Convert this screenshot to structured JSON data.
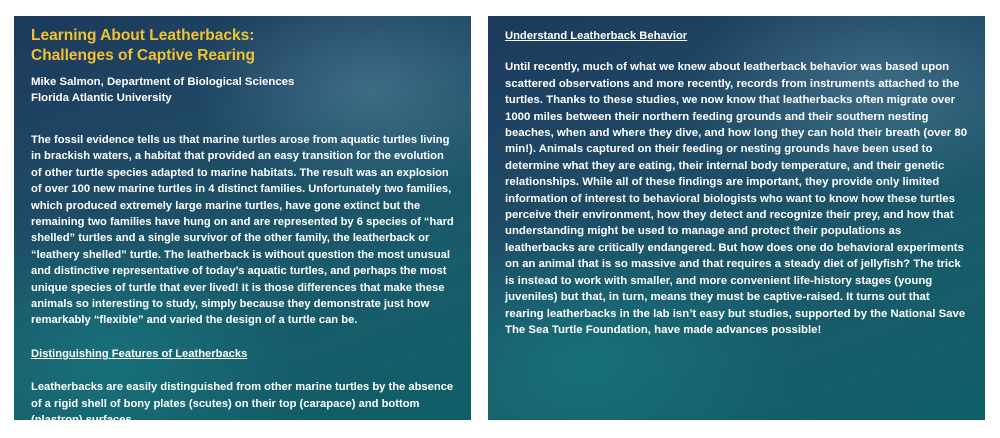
{
  "left_panel": {
    "title_line1": "Learning About Leatherbacks:",
    "title_line2": "Challenges of Captive Rearing",
    "author_line1": "Mike Salmon, Department of Biological Sciences",
    "author_line2": "Florida Atlantic University",
    "paragraph1": "The fossil evidence tells us that marine turtles arose from aquatic turtles living in brackish waters, a habitat that provided an easy transition for the evolution of other turtle species adapted to marine habitats. The result was an explosion of over 100 new marine turtles in 4 distinct families. Unfortunately two families, which produced extremely large marine turtles, have gone extinct but the remaining two families have hung on and are represented by 6 species of “hard shelled” turtles and a single survivor of the other family, the leatherback or “leathery shelled” turtle. The leatherback is without question the most unusual and distinctive representative of today’s aquatic turtles, and perhaps the most unique species of turtle that ever lived! It is those differences that make these animals so interesting to study, simply because they demonstrate just how remarkably “flexible” and varied the design of a turtle can be.",
    "heading": "Distinguishing Features of Leatherbacks",
    "paragraph2": "Leatherbacks are easily distinguished from other marine turtles by the absence of a rigid shell of bony plates (scutes) on their top (carapace) and bottom (plastron) surfaces."
  },
  "right_panel": {
    "heading": "Understand Leatherback Behavior",
    "paragraph": "Until recently, much of what we knew about leatherback behavior was based upon scattered observations and more recently, records from instruments attached to the turtles. Thanks to these studies, we now know that leatherbacks often migrate over 1000 miles between their northern feeding grounds and their southern nesting beaches, when and where they dive, and how long they can hold their breath (over 80 min!). Animals captured on their feeding or nesting grounds have been used to determine what they are eating, their internal body temperature, and their genetic relationships. While all of these findings are important, they provide only limited information of interest to behavioral biologists who want to know how these turtles perceive their environment, how they detect and recognize their prey, and how that understanding might be used to manage and protect their populations as leatherbacks are critically endangered. But how does one do behavioral experiments on an animal that is so massive and that requires a steady diet of jellyfish? The trick is instead to work with smaller, and more convenient life-history stages (young juveniles) but that, in turn, means they must be captive-raised. It turns out that rearing leatherbacks in the lab isn’t easy but studies, supported by the National Save The Sea Turtle Foundation, have made advances possible!"
  },
  "colors": {
    "title": "#f2c230",
    "text": "#ffffff",
    "panel_background": "#1f4a66"
  }
}
